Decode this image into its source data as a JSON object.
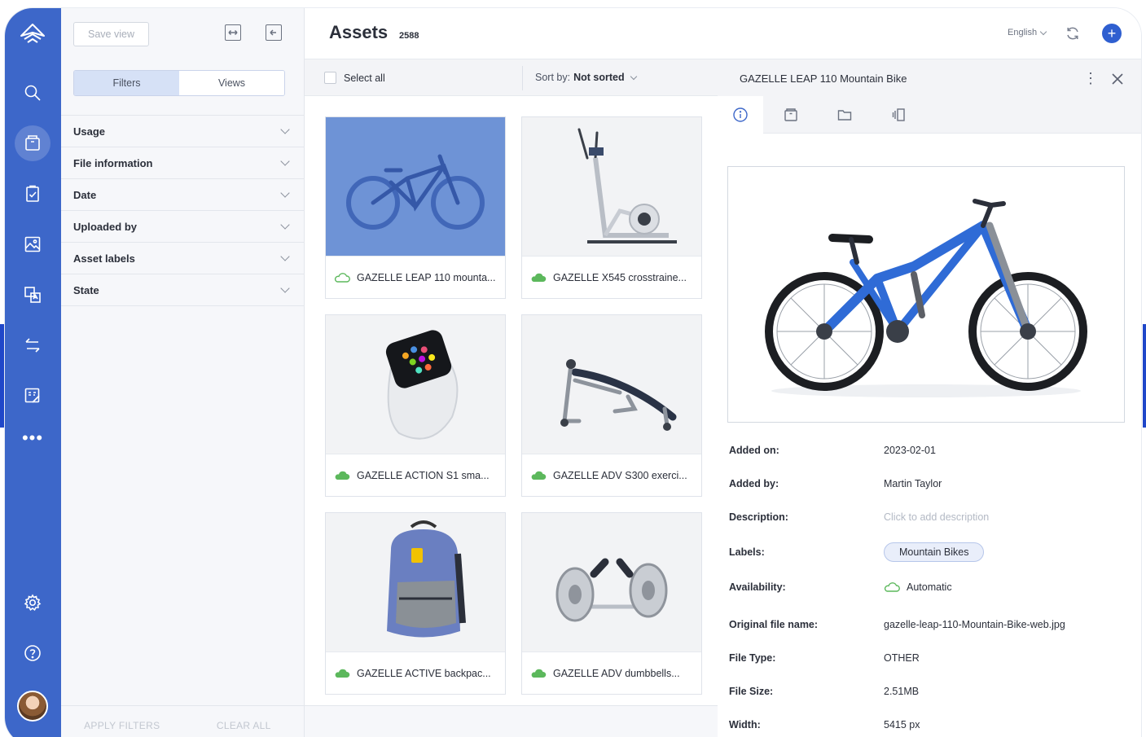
{
  "nav": {
    "items": [
      "logo",
      "search",
      "assets",
      "tasks",
      "images",
      "translate",
      "transfer",
      "forms",
      "more",
      "settings",
      "help",
      "avatar"
    ]
  },
  "filters": {
    "save_view_label": "Save view",
    "tabs": [
      "Filters",
      "Views"
    ],
    "facets": [
      "Usage",
      "File information",
      "Date",
      "Uploaded by",
      "Asset labels",
      "State"
    ],
    "apply_label": "APPLY FILTERS",
    "clear_label": "CLEAR ALL"
  },
  "header": {
    "title": "Assets",
    "count": "2588",
    "language": "English"
  },
  "toolbar": {
    "select_all": "Select all",
    "sort_prefix": "Sort by:",
    "sort_value": "Not sorted"
  },
  "assets": [
    {
      "caption": "GAZELLE LEAP 110 mounta...",
      "cloud": "outline",
      "selected": true
    },
    {
      "caption": "GAZELLE X545 crosstraine...",
      "cloud": "filled",
      "selected": false
    },
    {
      "caption": "GAZELLE ACTION S1 sma...",
      "cloud": "filled",
      "selected": false
    },
    {
      "caption": "GAZELLE ADV S300 exerci...",
      "cloud": "filled",
      "selected": false
    },
    {
      "caption": "GAZELLE ACTIVE backpac...",
      "cloud": "filled",
      "selected": false
    },
    {
      "caption": "GAZELLE ADV dumbbells...",
      "cloud": "filled",
      "selected": false
    }
  ],
  "detail": {
    "title": "GAZELLE LEAP 110 Mountain Bike",
    "fields": [
      {
        "key": "Added on:",
        "value": "2023-02-01"
      },
      {
        "key": "Added by:",
        "value": "Martin Taylor"
      },
      {
        "key": "Description:",
        "value": "Click to add description"
      },
      {
        "key": "Labels:",
        "value": "Mountain Bikes"
      },
      {
        "key": "Availability:",
        "value": "Automatic"
      },
      {
        "key": "Original file name:",
        "value": "gazelle-leap-110-Mountain-Bike-web.jpg"
      },
      {
        "key": "File Type:",
        "value": "OTHER"
      },
      {
        "key": "File Size:",
        "value": "2.51MB"
      },
      {
        "key": "Width:",
        "value": "5415 px"
      }
    ]
  },
  "colors": {
    "rail": "#3d67c9",
    "accent": "#2f5fd0",
    "selected_thumb": "#6e93d6",
    "cloud_green": "#5cb85c"
  }
}
